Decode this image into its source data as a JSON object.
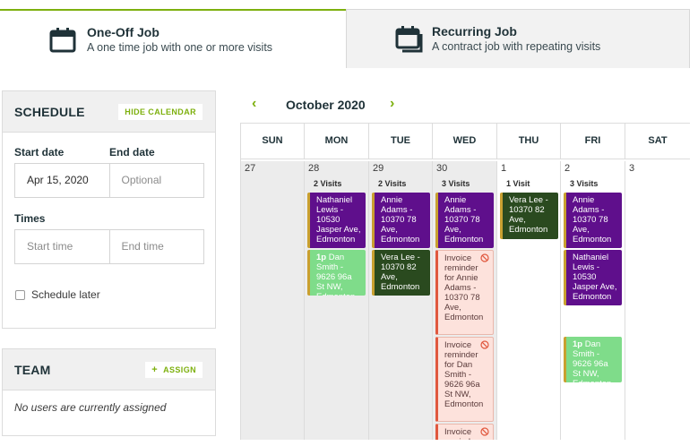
{
  "tabs": {
    "oneoff": {
      "title": "One-Off Job",
      "subtitle": "A one time job with one or more visits",
      "icon": "calendar-icon"
    },
    "recurring": {
      "title": "Recurring Job",
      "subtitle": "A contract job with repeating visits",
      "icon": "calendar-stack-icon"
    }
  },
  "schedule": {
    "title": "SCHEDULE",
    "hide_calendar": "HIDE CALENDAR",
    "start_date_label": "Start date",
    "end_date_label": "End date",
    "start_date_value": "Apr 15, 2020",
    "end_date_placeholder": "Optional",
    "times_label": "Times",
    "start_time_placeholder": "Start time",
    "end_time_placeholder": "End time",
    "schedule_later": "Schedule later"
  },
  "team": {
    "title": "TEAM",
    "assign": "ASSIGN",
    "assign_icon": "plus-icon",
    "empty": "No users are currently assigned"
  },
  "calendar": {
    "month": "October 2020",
    "weekdays": [
      "SUN",
      "MON",
      "TUE",
      "WED",
      "THU",
      "FRI",
      "SAT"
    ],
    "days": [
      {
        "num": "27",
        "visits": ""
      },
      {
        "num": "28",
        "visits": "2 Visits"
      },
      {
        "num": "29",
        "visits": "2 Visits"
      },
      {
        "num": "30",
        "visits": "3 Visits"
      },
      {
        "num": "1",
        "visits": "1 Visit"
      },
      {
        "num": "2",
        "visits": "3 Visits"
      },
      {
        "num": "3",
        "visits": ""
      }
    ],
    "events": {
      "mon_1": "Nathaniel Lewis - 10530 Jasper Ave, Edmonton",
      "mon_2_time": "1p",
      "mon_2": "Dan Smith - 9626 96a St NW, Edmonton",
      "tue_1": "Annie Adams - 10370 78 Ave, Edmonton",
      "tue_2": "Vera Lee - 10370 82 Ave, Edmonton",
      "wed_1": "Annie Adams - 10370 78 Ave, Edmonton",
      "wed_2": "Invoice reminder for Annie Adams - 10370 78 Ave, Edmonton",
      "wed_3": "Invoice reminder for Dan Smith - 9626 96a St NW, Edmonton",
      "wed_4": "Invoice reminder",
      "thu_1": "Vera Lee - 10370 82 Ave, Edmonton",
      "fri_1": "Annie Adams - 10370 78 Ave, Edmonton",
      "fri_2": "Nathaniel Lewis - 10530 Jasper Ave, Edmonton",
      "fri_3_time": "1p",
      "fri_3": "Dan Smith - 9626 96a St NW, Edmonton"
    },
    "colors": {
      "visit_purple": "#5f0f8c",
      "visit_dark_green": "#2a4a1f",
      "visit_light_green": "#7fdc8a",
      "reminder_pink": "#fde2dc",
      "accent": "#7db00e"
    }
  }
}
